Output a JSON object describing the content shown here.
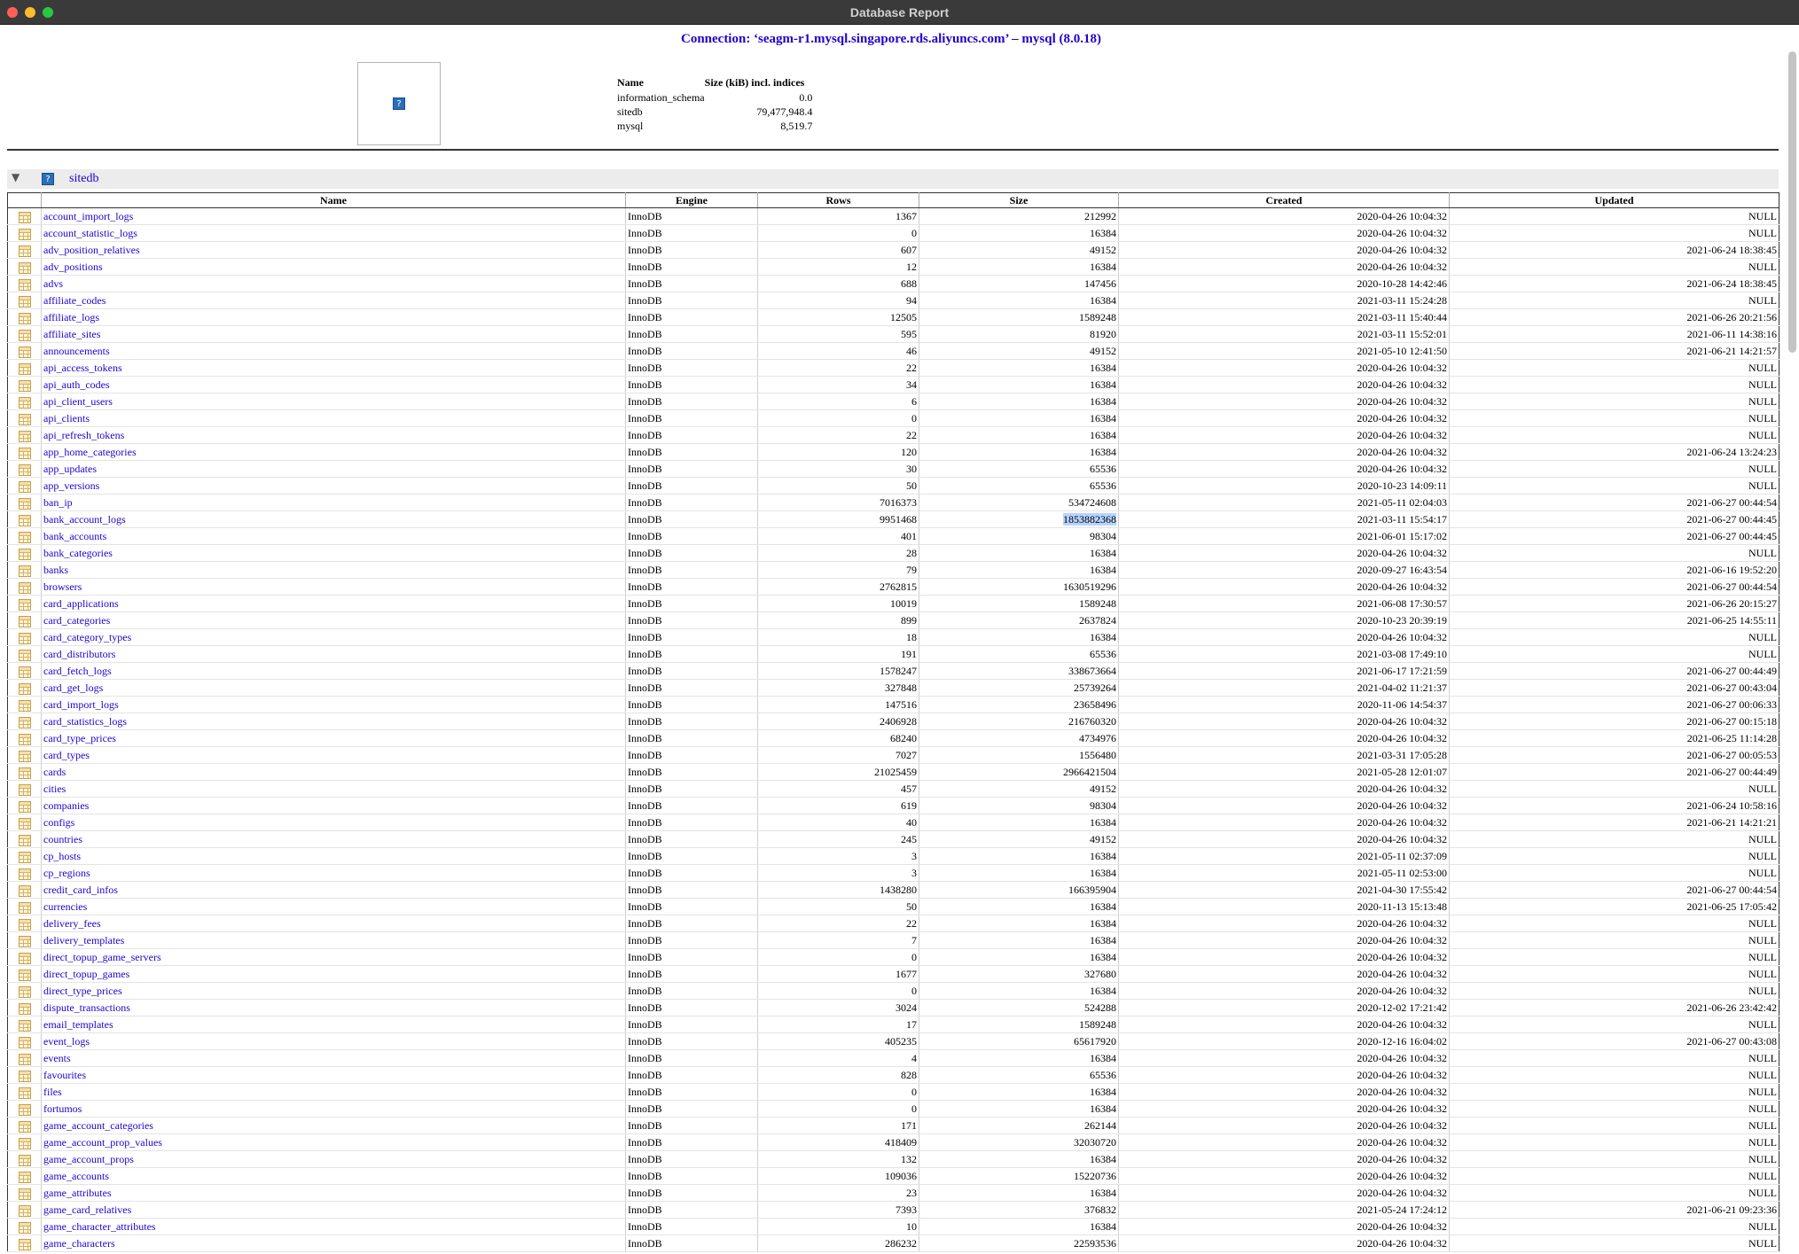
{
  "window": {
    "title": "Database Report"
  },
  "connection": "Connection: ‘seagm-r1.mysql.singapore.rds.aliyuncs.com’ – mysql (8.0.18)",
  "summary": {
    "headers": [
      "Name",
      "Size (kiB) incl. indices"
    ],
    "rows": [
      [
        "information_schema",
        "0.0"
      ],
      [
        "sitedb",
        "79,477,948.4"
      ],
      [
        "mysql",
        "8,519.7"
      ]
    ]
  },
  "database": {
    "name": "sitedb",
    "collapse_arrow": "▼",
    "icon": "question-icon"
  },
  "table": {
    "headers": [
      "Name",
      "Engine",
      "Rows",
      "Size",
      "Created",
      "Updated"
    ],
    "rows": [
      [
        "account_import_logs",
        "InnoDB",
        "1367",
        "212992",
        "2020-04-26 10:04:32",
        "NULL"
      ],
      [
        "account_statistic_logs",
        "InnoDB",
        "0",
        "16384",
        "2020-04-26 10:04:32",
        "NULL"
      ],
      [
        "adv_position_relatives",
        "InnoDB",
        "607",
        "49152",
        "2020-04-26 10:04:32",
        "2021-06-24 18:38:45"
      ],
      [
        "adv_positions",
        "InnoDB",
        "12",
        "16384",
        "2020-04-26 10:04:32",
        "NULL"
      ],
      [
        "advs",
        "InnoDB",
        "688",
        "147456",
        "2020-10-28 14:42:46",
        "2021-06-24 18:38:45"
      ],
      [
        "affiliate_codes",
        "InnoDB",
        "94",
        "16384",
        "2021-03-11 15:24:28",
        "NULL"
      ],
      [
        "affiliate_logs",
        "InnoDB",
        "12505",
        "1589248",
        "2021-03-11 15:40:44",
        "2021-06-26 20:21:56"
      ],
      [
        "affiliate_sites",
        "InnoDB",
        "595",
        "81920",
        "2021-03-11 15:52:01",
        "2021-06-11 14:38:16"
      ],
      [
        "announcements",
        "InnoDB",
        "46",
        "49152",
        "2021-05-10 12:41:50",
        "2021-06-21 14:21:57"
      ],
      [
        "api_access_tokens",
        "InnoDB",
        "22",
        "16384",
        "2020-04-26 10:04:32",
        "NULL"
      ],
      [
        "api_auth_codes",
        "InnoDB",
        "34",
        "16384",
        "2020-04-26 10:04:32",
        "NULL"
      ],
      [
        "api_client_users",
        "InnoDB",
        "6",
        "16384",
        "2020-04-26 10:04:32",
        "NULL"
      ],
      [
        "api_clients",
        "InnoDB",
        "0",
        "16384",
        "2020-04-26 10:04:32",
        "NULL"
      ],
      [
        "api_refresh_tokens",
        "InnoDB",
        "22",
        "16384",
        "2020-04-26 10:04:32",
        "NULL"
      ],
      [
        "app_home_categories",
        "InnoDB",
        "120",
        "16384",
        "2020-04-26 10:04:32",
        "2021-06-24 13:24:23"
      ],
      [
        "app_updates",
        "InnoDB",
        "30",
        "65536",
        "2020-04-26 10:04:32",
        "NULL"
      ],
      [
        "app_versions",
        "InnoDB",
        "50",
        "65536",
        "2020-10-23 14:09:11",
        "NULL"
      ],
      [
        "ban_ip",
        "InnoDB",
        "7016373",
        "534724608",
        "2021-05-11 02:04:03",
        "2021-06-27 00:44:54"
      ],
      [
        "bank_account_logs",
        "InnoDB",
        "9951468",
        "1853882368",
        "2021-03-11 15:54:17",
        "2021-06-27 00:44:45"
      ],
      [
        "bank_accounts",
        "InnoDB",
        "401",
        "98304",
        "2021-06-01 15:17:02",
        "2021-06-27 00:44:45"
      ],
      [
        "bank_categories",
        "InnoDB",
        "28",
        "16384",
        "2020-04-26 10:04:32",
        "NULL"
      ],
      [
        "banks",
        "InnoDB",
        "79",
        "16384",
        "2020-09-27 16:43:54",
        "2021-06-16 19:52:20"
      ],
      [
        "browsers",
        "InnoDB",
        "2762815",
        "1630519296",
        "2020-04-26 10:04:32",
        "2021-06-27 00:44:54"
      ],
      [
        "card_applications",
        "InnoDB",
        "10019",
        "1589248",
        "2021-06-08 17:30:57",
        "2021-06-26 20:15:27"
      ],
      [
        "card_categories",
        "InnoDB",
        "899",
        "2637824",
        "2020-10-23 20:39:19",
        "2021-06-25 14:55:11"
      ],
      [
        "card_category_types",
        "InnoDB",
        "18",
        "16384",
        "2020-04-26 10:04:32",
        "NULL"
      ],
      [
        "card_distributors",
        "InnoDB",
        "191",
        "65536",
        "2021-03-08 17:49:10",
        "NULL"
      ],
      [
        "card_fetch_logs",
        "InnoDB",
        "1578247",
        "338673664",
        "2021-06-17 17:21:59",
        "2021-06-27 00:44:49"
      ],
      [
        "card_get_logs",
        "InnoDB",
        "327848",
        "25739264",
        "2021-04-02 11:21:37",
        "2021-06-27 00:43:04"
      ],
      [
        "card_import_logs",
        "InnoDB",
        "147516",
        "23658496",
        "2020-11-06 14:54:37",
        "2021-06-27 00:06:33"
      ],
      [
        "card_statistics_logs",
        "InnoDB",
        "2406928",
        "216760320",
        "2020-04-26 10:04:32",
        "2021-06-27 00:15:18"
      ],
      [
        "card_type_prices",
        "InnoDB",
        "68240",
        "4734976",
        "2020-04-26 10:04:32",
        "2021-06-25 11:14:28"
      ],
      [
        "card_types",
        "InnoDB",
        "7027",
        "1556480",
        "2021-03-31 17:05:28",
        "2021-06-27 00:05:53"
      ],
      [
        "cards",
        "InnoDB",
        "21025459",
        "2966421504",
        "2021-05-28 12:01:07",
        "2021-06-27 00:44:49"
      ],
      [
        "cities",
        "InnoDB",
        "457",
        "49152",
        "2020-04-26 10:04:32",
        "NULL"
      ],
      [
        "companies",
        "InnoDB",
        "619",
        "98304",
        "2020-04-26 10:04:32",
        "2021-06-24 10:58:16"
      ],
      [
        "configs",
        "InnoDB",
        "40",
        "16384",
        "2020-04-26 10:04:32",
        "2021-06-21 14:21:21"
      ],
      [
        "countries",
        "InnoDB",
        "245",
        "49152",
        "2020-04-26 10:04:32",
        "NULL"
      ],
      [
        "cp_hosts",
        "InnoDB",
        "3",
        "16384",
        "2021-05-11 02:37:09",
        "NULL"
      ],
      [
        "cp_regions",
        "InnoDB",
        "3",
        "16384",
        "2021-05-11 02:53:00",
        "NULL"
      ],
      [
        "credit_card_infos",
        "InnoDB",
        "1438280",
        "166395904",
        "2021-04-30 17:55:42",
        "2021-06-27 00:44:54"
      ],
      [
        "currencies",
        "InnoDB",
        "50",
        "16384",
        "2020-11-13 15:13:48",
        "2021-06-25 17:05:42"
      ],
      [
        "delivery_fees",
        "InnoDB",
        "22",
        "16384",
        "2020-04-26 10:04:32",
        "NULL"
      ],
      [
        "delivery_templates",
        "InnoDB",
        "7",
        "16384",
        "2020-04-26 10:04:32",
        "NULL"
      ],
      [
        "direct_topup_game_servers",
        "InnoDB",
        "0",
        "16384",
        "2020-04-26 10:04:32",
        "NULL"
      ],
      [
        "direct_topup_games",
        "InnoDB",
        "1677",
        "327680",
        "2020-04-26 10:04:32",
        "NULL"
      ],
      [
        "direct_type_prices",
        "InnoDB",
        "0",
        "16384",
        "2020-04-26 10:04:32",
        "NULL"
      ],
      [
        "dispute_transactions",
        "InnoDB",
        "3024",
        "524288",
        "2020-12-02 17:21:42",
        "2021-06-26 23:42:42"
      ],
      [
        "email_templates",
        "InnoDB",
        "17",
        "1589248",
        "2020-04-26 10:04:32",
        "NULL"
      ],
      [
        "event_logs",
        "InnoDB",
        "405235",
        "65617920",
        "2020-12-16 16:04:02",
        "2021-06-27 00:43:08"
      ],
      [
        "events",
        "InnoDB",
        "4",
        "16384",
        "2020-04-26 10:04:32",
        "NULL"
      ],
      [
        "favourites",
        "InnoDB",
        "828",
        "65536",
        "2020-04-26 10:04:32",
        "NULL"
      ],
      [
        "files",
        "InnoDB",
        "0",
        "16384",
        "2020-04-26 10:04:32",
        "NULL"
      ],
      [
        "fortumos",
        "InnoDB",
        "0",
        "16384",
        "2020-04-26 10:04:32",
        "NULL"
      ],
      [
        "game_account_categories",
        "InnoDB",
        "171",
        "262144",
        "2020-04-26 10:04:32",
        "NULL"
      ],
      [
        "game_account_prop_values",
        "InnoDB",
        "418409",
        "32030720",
        "2020-04-26 10:04:32",
        "NULL"
      ],
      [
        "game_account_props",
        "InnoDB",
        "132",
        "16384",
        "2020-04-26 10:04:32",
        "NULL"
      ],
      [
        "game_accounts",
        "InnoDB",
        "109036",
        "15220736",
        "2020-04-26 10:04:32",
        "NULL"
      ],
      [
        "game_attributes",
        "InnoDB",
        "23",
        "16384",
        "2020-04-26 10:04:32",
        "NULL"
      ],
      [
        "game_card_relatives",
        "InnoDB",
        "7393",
        "376832",
        "2021-05-24 17:24:12",
        "2021-06-21 09:23:36"
      ],
      [
        "game_character_attributes",
        "InnoDB",
        "10",
        "16384",
        "2020-04-26 10:04:32",
        "NULL"
      ],
      [
        "game_characters",
        "InnoDB",
        "286232",
        "22593536",
        "2020-04-26 10:04:32",
        "NULL"
      ]
    ],
    "highlighted_cell": {
      "row": 18,
      "col": 3
    }
  }
}
